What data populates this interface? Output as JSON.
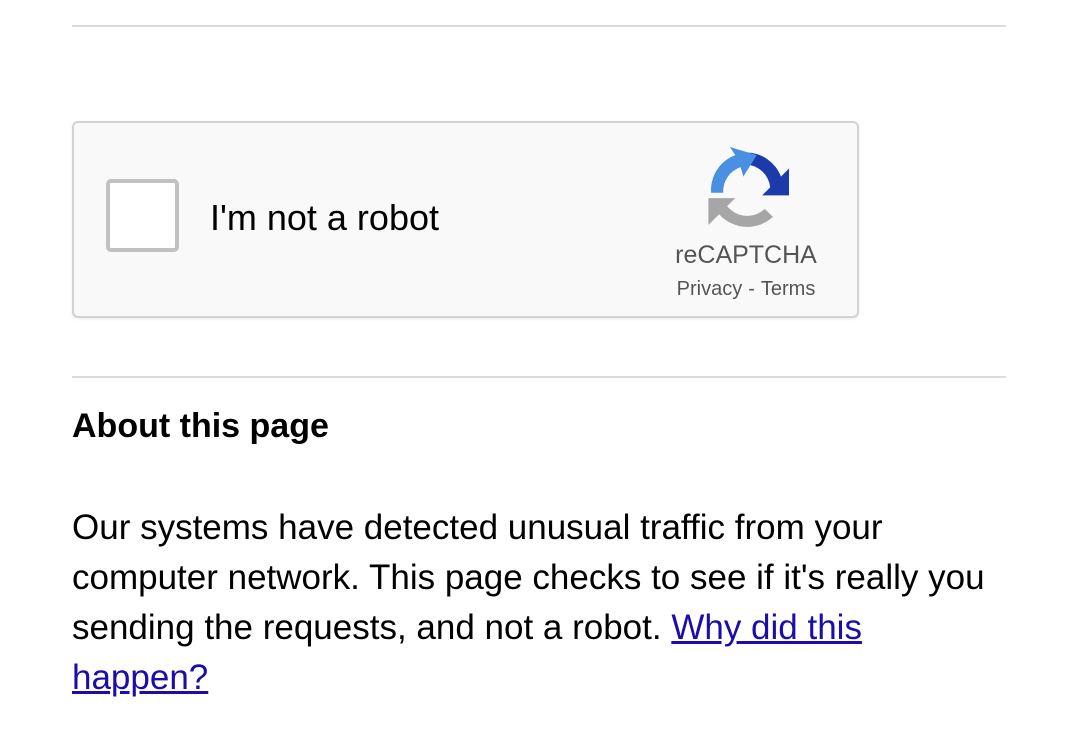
{
  "captcha": {
    "checkbox_label": "I'm not a robot",
    "checked": false,
    "brand_name": "reCAPTCHA",
    "privacy_link": "Privacy",
    "separator": "-",
    "terms_link": "Terms"
  },
  "about": {
    "heading": "About this page",
    "body": "Our systems have detected unusual traffic from your computer network. This page checks to see if it's really you sending the requests, and not a robot.",
    "link_text": "Why did this happen?"
  },
  "colors": {
    "link": "#1a0dab",
    "logo_blue_dark": "#1c3aa9",
    "logo_blue_light": "#4a90e2",
    "logo_gray": "#a6a6a6"
  }
}
